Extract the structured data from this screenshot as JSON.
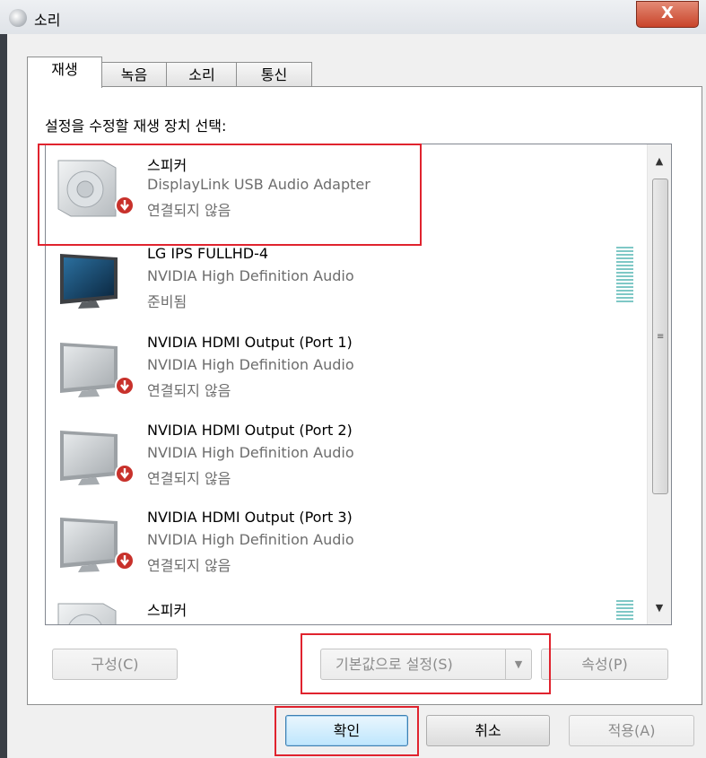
{
  "window": {
    "title": "소리",
    "close_label": "X"
  },
  "tabs": [
    {
      "label": "재생"
    },
    {
      "label": "녹음"
    },
    {
      "label": "소리"
    },
    {
      "label": "통신"
    }
  ],
  "instruction": "설정을 수정할 재생 장치 선택:",
  "devices": [
    {
      "name": "스피커",
      "description": "DisplayLink USB Audio Adapter",
      "status": "연결되지 않음",
      "icon": "speaker-icon"
    },
    {
      "name": "LG IPS FULLHD-4",
      "description": "NVIDIA High Definition Audio",
      "status": "준비됨",
      "icon": "monitor-icon"
    },
    {
      "name": "NVIDIA HDMI Output (Port 1)",
      "description": "NVIDIA High Definition Audio",
      "status": "연결되지 않음",
      "icon": "monitor-icon"
    },
    {
      "name": "NVIDIA HDMI Output (Port 2)",
      "description": "NVIDIA High Definition Audio",
      "status": "연결되지 않음",
      "icon": "monitor-icon"
    },
    {
      "name": "NVIDIA HDMI Output (Port 3)",
      "description": "NVIDIA High Definition Audio",
      "status": "연결되지 않음",
      "icon": "monitor-icon"
    },
    {
      "name": "스피커",
      "icon": "speaker-icon"
    }
  ],
  "buttons": {
    "configure": "구성(C)",
    "set_default": "기본값으로 설정(S)",
    "properties": "속성(P)",
    "ok": "확인",
    "cancel": "취소",
    "apply": "적용(A)"
  },
  "colors": {
    "highlight": "#e0232e",
    "level_meter": "#7fc8c6",
    "disconnected_badge": "#c8312b"
  }
}
